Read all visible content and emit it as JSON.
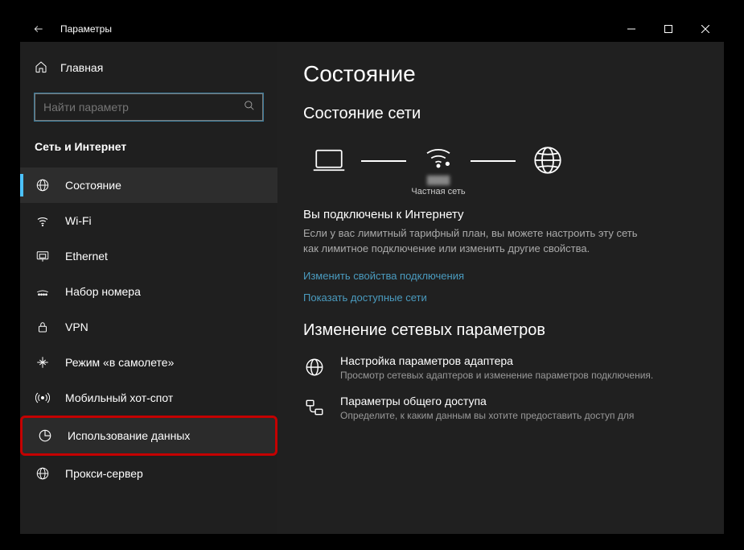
{
  "window": {
    "title": "Параметры"
  },
  "sidebar": {
    "home": "Главная",
    "search_placeholder": "Найти параметр",
    "section": "Сеть и Интернет",
    "items": [
      {
        "label": "Состояние"
      },
      {
        "label": "Wi-Fi"
      },
      {
        "label": "Ethernet"
      },
      {
        "label": "Набор номера"
      },
      {
        "label": "VPN"
      },
      {
        "label": "Режим «в самолете»"
      },
      {
        "label": "Мобильный хот-спот"
      },
      {
        "label": "Использование данных"
      },
      {
        "label": "Прокси-сервер"
      }
    ]
  },
  "main": {
    "title": "Состояние",
    "subtitle": "Состояние сети",
    "private_network": "Частная сеть",
    "connected_title": "Вы подключены к Интернету",
    "connected_body": "Если у вас лимитный тарифный план, вы можете настроить эту сеть как лимитное подключение или изменить другие свойства.",
    "link_props": "Изменить свойства подключения",
    "link_networks": "Показать доступные сети",
    "change_heading": "Изменение сетевых параметров",
    "option1_title": "Настройка параметров адаптера",
    "option1_desc": "Просмотр сетевых адаптеров и изменение параметров подключения.",
    "option2_title": "Параметры общего доступа",
    "option2_desc": "Определите, к каким данным вы хотите предоставить доступ для"
  }
}
